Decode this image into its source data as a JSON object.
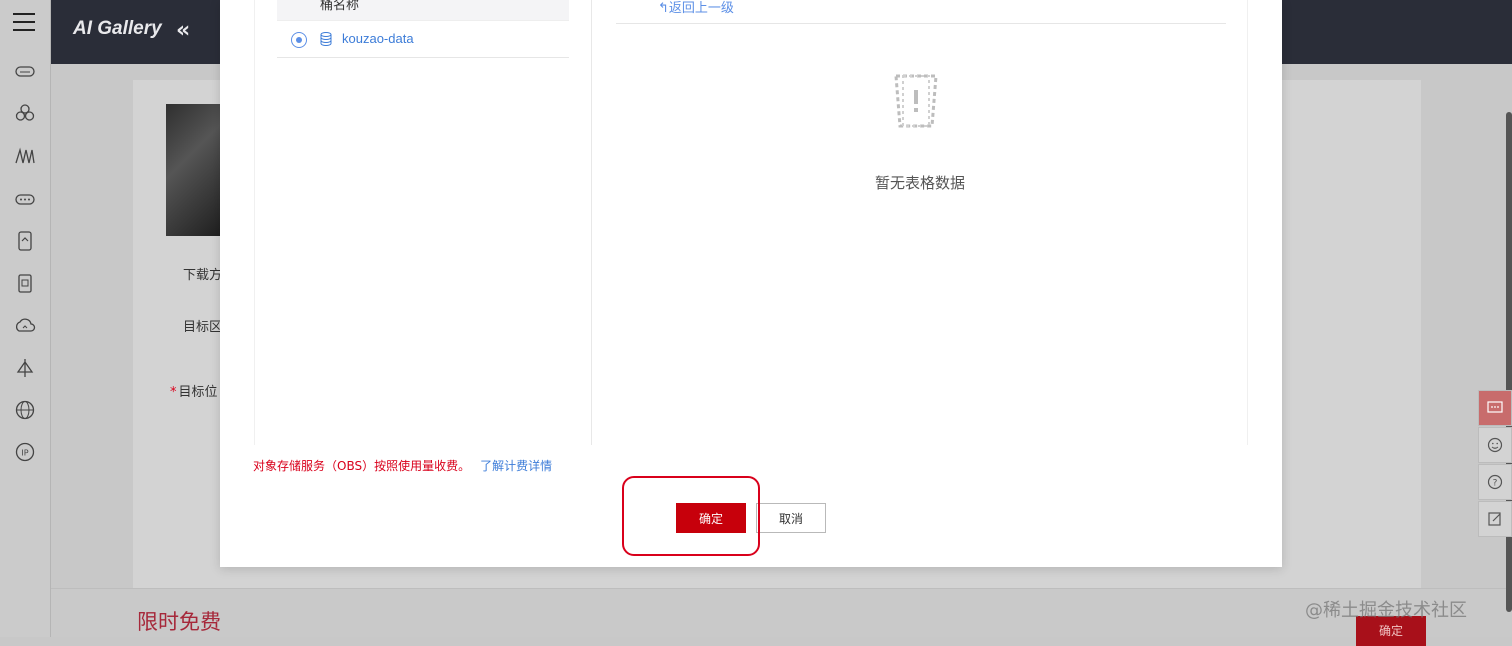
{
  "header": {
    "brand": "AI Gallery",
    "collapse_glyph": "«"
  },
  "rail": {
    "icons": [
      "cloud-icon",
      "cluster-icon",
      "signal-icon",
      "storage-icon",
      "file-icon",
      "document-icon",
      "cloud-sync-icon",
      "satellite-icon",
      "globe-icon",
      "ip-icon"
    ]
  },
  "background_form": {
    "label_download": "下载方",
    "label_region": "目标区",
    "label_location": "目标位",
    "promo": "限时免费",
    "confirm_label": "确定"
  },
  "dialog": {
    "bucket_column_header": "桶名称",
    "buckets": [
      {
        "name": "kouzao-data",
        "selected": true
      }
    ],
    "back_link": "↰返回上一级",
    "empty_text": "暂无表格数据",
    "billing_note": "对象存储服务（OBS）按照使用量收费。",
    "billing_link": "了解计费详情",
    "confirm_label": "确定",
    "cancel_label": "取消"
  },
  "watermark": "@稀土掘金技术社区",
  "colors": {
    "primary_red": "#c7000b",
    "link_blue": "#3c7cd8",
    "header_dark": "#2a2d38"
  }
}
